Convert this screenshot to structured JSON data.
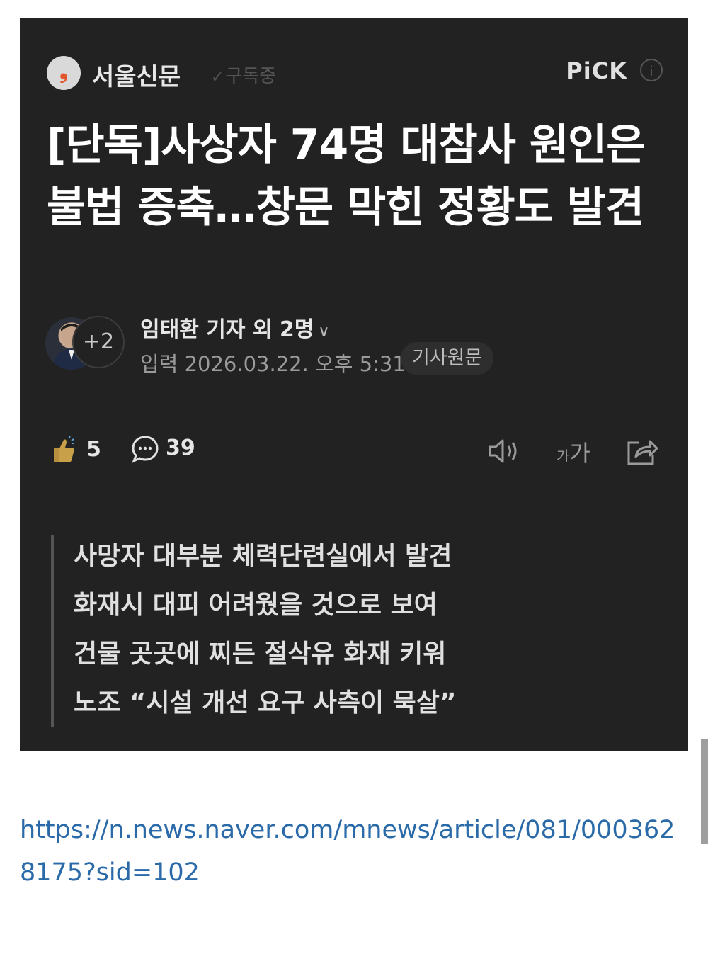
{
  "press": {
    "name": "서울신문",
    "logo_glyph": "❟",
    "subscribe_check": "✓",
    "subscribe_label": "구독중",
    "pick_label": "PiCK",
    "info_glyph": "i"
  },
  "article": {
    "headline": "[단독]사상자 74명 대참사 원인은 불법 증축…창문 막힌 정황도 발견",
    "avatar_more": "+2",
    "reporter": "임태환 기자 외 2명",
    "reporter_chevron": "∨",
    "date": "입력 2026.03.22. 오후 5:31",
    "origin_button": "기사원문"
  },
  "actions": {
    "like_count": "5",
    "comment_count": "39",
    "font_small": "가",
    "font_large": "가"
  },
  "summary": [
    "사망자 대부분 체력단련실에서 발견",
    "화재시 대피 어려웠을 것으로 보여",
    "건물 곳곳에 찌든 절삭유 화재 키워",
    "노조 “시설 개선 요구 사측이 묵살”"
  ],
  "link": "https://n.news.naver.com/mnews/article/081/0003628175?sid=102",
  "colors": {
    "card_bg": "#222222",
    "link": "#2a6aa8",
    "press_logo": "#e2572b",
    "like_icon": "#c9a04a"
  }
}
